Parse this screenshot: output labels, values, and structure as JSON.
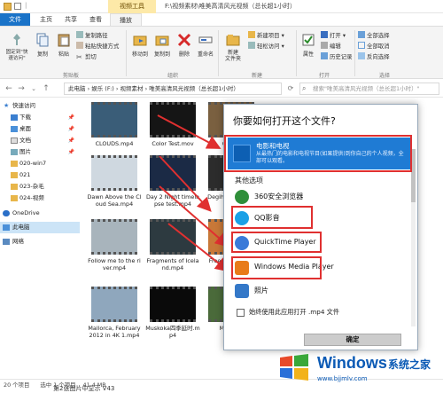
{
  "window": {
    "title": "F:\\视频素材\\唯美高清风光视频（总长超1小时）",
    "context_tab": "视频工具"
  },
  "ribbon_tabs": [
    "文件",
    "主页",
    "共享",
    "查看",
    "播放"
  ],
  "ribbon": {
    "pin_label": "固定到\"快速访问\"",
    "copy_label": "复制",
    "paste_label": "粘贴",
    "copy_path_label": "复制路径",
    "paste_shortcut_label": "粘贴快捷方式",
    "cut_label": "剪切",
    "move_to_label": "移动到",
    "copy_to_label": "复制到",
    "delete_label": "删除",
    "rename_label": "重命名",
    "new_folder_label": "新建\n文件夹",
    "new_item_label": "新建项目 ▾",
    "easy_access_label": "轻松访问 ▾",
    "properties_label": "属性",
    "open_label": "打开 ▾",
    "edit_label": "编辑",
    "history_label": "历史记录",
    "select_all_label": "全部选择",
    "select_none_label": "全部取消",
    "invert_label": "反向选择",
    "groups": [
      "剪贴板",
      "组织",
      "新建",
      "打开",
      "选择"
    ]
  },
  "address": {
    "path": "此电脑 › 娱乐 (F:) › 视频素材 › 唯美高清风光视频（总长超1小时）",
    "search_placeholder": "搜索\"唯美高清风光视频（总长超1小时）\""
  },
  "nav": {
    "quick_access": "快速访问",
    "items": [
      "下载",
      "桌面",
      "文档",
      "图片",
      "020-win7",
      "021",
      "023-杂毛",
      "024-视频"
    ],
    "onedrive": "OneDrive",
    "this_pc": "此电脑",
    "network": "网络"
  },
  "files": [
    {
      "name": "CLOUDS.mp4",
      "color": "#3a5d78"
    },
    {
      "name": "Color Test.mov",
      "color": "#151515"
    },
    {
      "name": "Coque",
      "color": "#7a6040"
    },
    {
      "name": "Dawn Above the Cloud Sea.mp4",
      "color": "#cfd8e0"
    },
    {
      "name": "Day 2 Night timelapse test.mp4",
      "color": "#1b2a45"
    },
    {
      "name": "Degih autre Vide",
      "color": "#2c2c2c"
    },
    {
      "name": "Follow me to the river.mp4",
      "color": "#a8b4bc"
    },
    {
      "name": "Fragments of Iceland.mp4",
      "color": "#2d3a40"
    },
    {
      "name": "Free Tim sunset",
      "color": "#c87838"
    },
    {
      "name": "Mallorca, February 2012 in 4K 1.mp4",
      "color": "#8fa7bd"
    },
    {
      "name": "Muskoka四季延时.mp4",
      "color": "#0a0a0a"
    },
    {
      "name": "My Gard",
      "color": "#4a6a3a"
    }
  ],
  "status": {
    "count": "20 个项目",
    "selected": "选中 1 个项目",
    "size": "41.4 MB"
  },
  "dialog": {
    "title": "你要如何打开这个文件?",
    "recommended": {
      "name": "电影和电视",
      "desc": "从最热门的电影和电视节目(如果提供)到你自己的个人视频，全部可以观看。"
    },
    "other_label": "其他选项",
    "apps": [
      {
        "name": "360安全浏览器",
        "icon": "browser-icon",
        "color": "#2f8f3a"
      },
      {
        "name": "QQ影音",
        "icon": "qq-player-icon",
        "color": "#1aa0e6"
      },
      {
        "name": "QuickTime Player",
        "icon": "quicktime-icon",
        "color": "#3b7ad8"
      },
      {
        "name": "Windows Media Player",
        "icon": "wmp-icon",
        "color": "#e87b1a"
      },
      {
        "name": "照片",
        "icon": "photos-icon",
        "color": "#3478c8"
      }
    ],
    "always_use": "始终使用此应用打开 .mp4 文件",
    "ok_label": "确定"
  },
  "watermark": {
    "brand": "Windows",
    "name": "系统之家",
    "url": "www.bjjmlv.com"
  },
  "bottom_text": "第2张图片中显示 V43"
}
